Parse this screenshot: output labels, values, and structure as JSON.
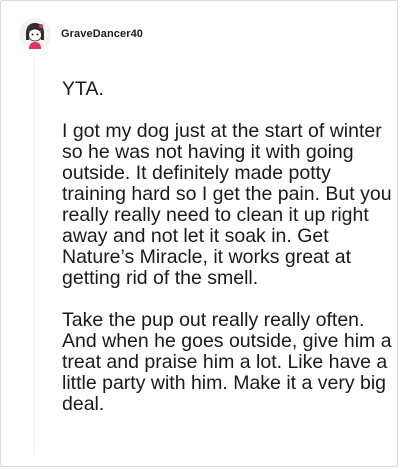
{
  "comment": {
    "username": "GraveDancer40",
    "avatar_icon": "snoo-avatar-icon",
    "paragraphs": [
      "YTA.",
      "I got my dog just at the start of winter so he was not having it with going outside. It definitely made potty training hard so I get the pain. But you really really need to clean it up right away and not let it soak in. Get Nature’s Miracle, it works great at getting rid of the smell.",
      "Take the pup out really really often. And when he goes outside, give him a treat and praise him a lot. Like have a little party with him. Make it a very big deal."
    ]
  },
  "colors": {
    "border": "#d7dadc",
    "thread_line": "#edeff1",
    "text": "#1a1a1b",
    "avatar_accent": "#e0335e"
  }
}
